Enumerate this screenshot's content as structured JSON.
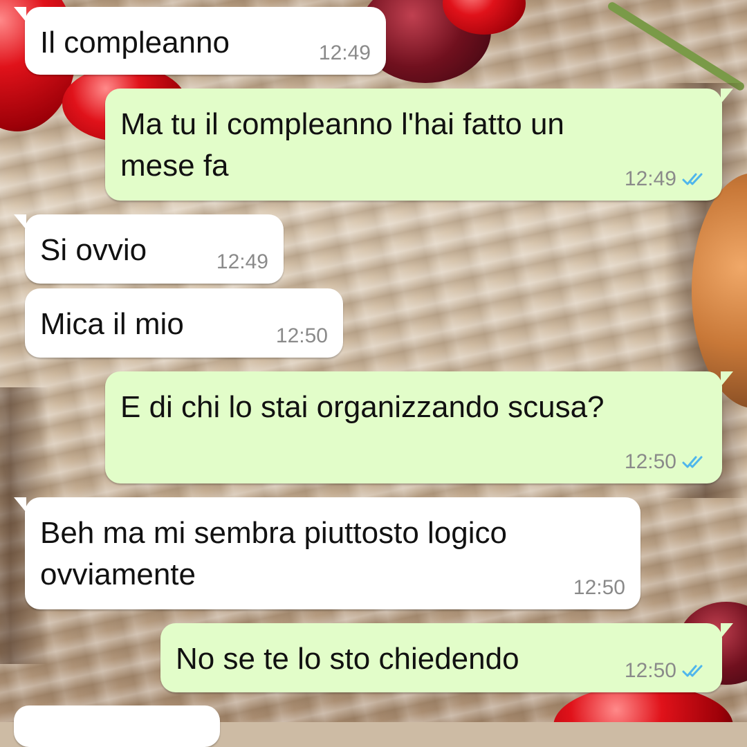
{
  "conversation": {
    "messages": [
      {
        "direction": "incoming",
        "text": "Il compleanno",
        "time": "12:49"
      },
      {
        "direction": "outgoing",
        "text": "Ma tu il compleanno l'hai fatto un\nmese fa",
        "time": "12:49",
        "status": "read"
      },
      {
        "direction": "incoming",
        "text": "Si ovvio",
        "time": "12:49"
      },
      {
        "direction": "incoming",
        "text": "Mica il mio",
        "time": "12:50"
      },
      {
        "direction": "outgoing",
        "text": "E di chi lo stai organizzando scusa?",
        "time": "12:50",
        "status": "read"
      },
      {
        "direction": "incoming",
        "text": "Beh ma mi sembra piuttosto logico\novviamente",
        "time": "12:50"
      },
      {
        "direction": "outgoing",
        "text": "No se te lo sto chiedendo",
        "time": "12:50",
        "status": "read"
      }
    ]
  },
  "icons": {
    "read_receipt": "double-check-icon"
  },
  "colors": {
    "incoming_bubble": "#ffffff",
    "outgoing_bubble": "#e2fdc9",
    "timestamp": "#8a8a8a",
    "read_ticks": "#4fb6ec"
  }
}
